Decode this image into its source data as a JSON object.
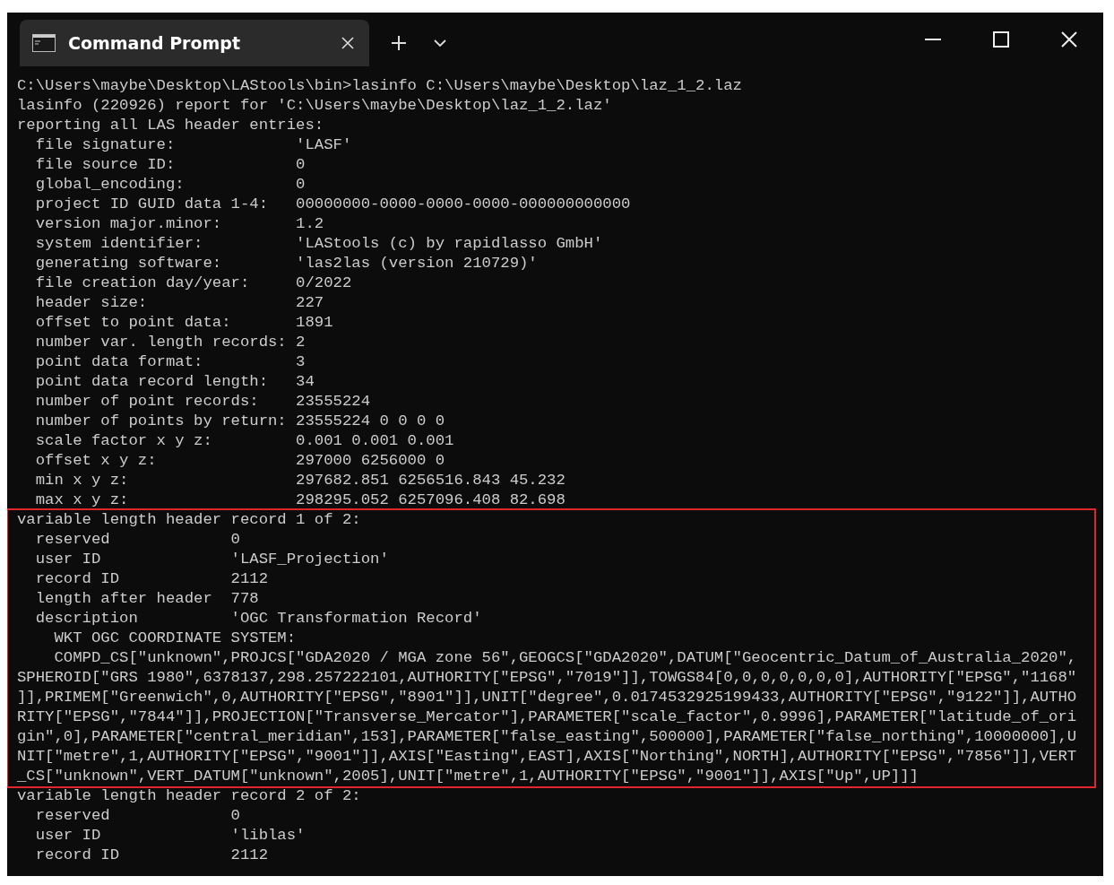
{
  "tabs": [
    {
      "title": "Command Prompt",
      "selected": true
    }
  ],
  "terminal": {
    "blocks": [
      {
        "highlighted": false,
        "lines": [
          "C:\\Users\\maybe\\Desktop\\LAStools\\bin>lasinfo C:\\Users\\maybe\\Desktop\\laz_1_2.laz",
          "lasinfo (220926) report for 'C:\\Users\\maybe\\Desktop\\laz_1_2.laz'",
          "reporting all LAS header entries:",
          "  file signature:             'LASF'",
          "  file source ID:             0",
          "  global_encoding:            0",
          "  project ID GUID data 1-4:   00000000-0000-0000-0000-000000000000",
          "  version major.minor:        1.2",
          "  system identifier:          'LAStools (c) by rapidlasso GmbH'",
          "  generating software:        'las2las (version 210729)'",
          "  file creation day/year:     0/2022",
          "  header size:                227",
          "  offset to point data:       1891",
          "  number var. length records: 2",
          "  point data format:          3",
          "  point data record length:   34",
          "  number of point records:    23555224",
          "  number of points by return: 23555224 0 0 0 0",
          "  scale factor x y z:         0.001 0.001 0.001",
          "  offset x y z:               297000 6256000 0",
          "  min x y z:                  297682.851 6256516.843 45.232",
          "  max x y z:                  298295.052 6257096.408 82.698"
        ]
      },
      {
        "highlighted": true,
        "lines": [
          "variable length header record 1 of 2:",
          "  reserved             0",
          "  user ID              'LASF_Projection'",
          "  record ID            2112",
          "  length after header  778",
          "  description          'OGC Transformation Record'",
          "    WKT OGC COORDINATE SYSTEM:",
          "    COMPD_CS[\"unknown\",PROJCS[\"GDA2020 / MGA zone 56\",GEOGCS[\"GDA2020\",DATUM[\"Geocentric_Datum_of_Australia_2020\",",
          "SPHEROID[\"GRS 1980\",6378137,298.257222101,AUTHORITY[\"EPSG\",\"7019\"]],TOWGS84[0,0,0,0,0,0,0],AUTHORITY[\"EPSG\",\"1168\"",
          "]],PRIMEM[\"Greenwich\",0,AUTHORITY[\"EPSG\",\"8901\"]],UNIT[\"degree\",0.0174532925199433,AUTHORITY[\"EPSG\",\"9122\"]],AUTHO",
          "RITY[\"EPSG\",\"7844\"]],PROJECTION[\"Transverse_Mercator\"],PARAMETER[\"scale_factor\",0.9996],PARAMETER[\"latitude_of_ori",
          "gin\",0],PARAMETER[\"central_meridian\",153],PARAMETER[\"false_easting\",500000],PARAMETER[\"false_northing\",10000000],U",
          "NIT[\"metre\",1,AUTHORITY[\"EPSG\",\"9001\"]],AXIS[\"Easting\",EAST],AXIS[\"Northing\",NORTH],AUTHORITY[\"EPSG\",\"7856\"]],VERT",
          "_CS[\"unknown\",VERT_DATUM[\"unknown\",2005],UNIT[\"metre\",1,AUTHORITY[\"EPSG\",\"9001\"]],AXIS[\"Up\",UP]]]"
        ]
      },
      {
        "highlighted": false,
        "lines": [
          "variable length header record 2 of 2:",
          "  reserved             0",
          "  user ID              'liblas'",
          "  record ID            2112"
        ]
      }
    ]
  }
}
